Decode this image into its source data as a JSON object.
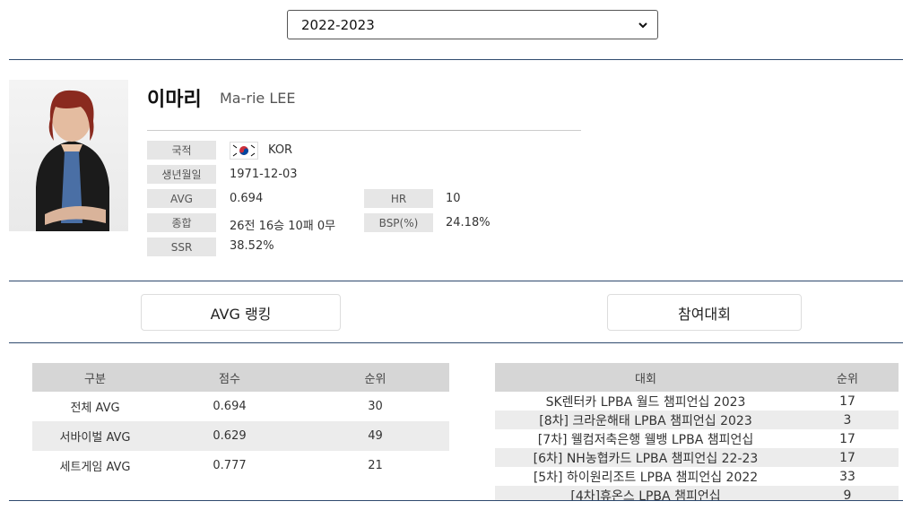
{
  "season_select": {
    "value": "2022-2023"
  },
  "player": {
    "name_ko": "이마리",
    "name_en": "Ma-rie LEE",
    "nationality_label": "국적",
    "nationality": "KOR",
    "birth_label": "생년월일",
    "birth": "1971-12-03",
    "avg_label": "AVG",
    "avg": "0.694",
    "hr_label": "HR",
    "hr": "10",
    "record_label": "종합",
    "record": "26전 16승 10패 0무",
    "bsp_label": "BSP(%)",
    "bsp": "24.18%",
    "ssr_label": "SSR",
    "ssr": "38.52%"
  },
  "tabs": {
    "avg_ranking": "AVG 랭킹",
    "tournaments": "참여대회"
  },
  "avg_table": {
    "headers": [
      "구분",
      "점수",
      "순위"
    ],
    "rows": [
      [
        "전체 AVG",
        "0.694",
        "30"
      ],
      [
        "서바이벌 AVG",
        "0.629",
        "49"
      ],
      [
        "세트게임 AVG",
        "0.777",
        "21"
      ]
    ]
  },
  "tour_table": {
    "headers": [
      "대회",
      "순위"
    ],
    "rows": [
      [
        "SK렌터카 LPBA 월드 챔피언십 2023",
        "17"
      ],
      [
        "[8차] 크라운해태 LPBA 챔피언십 2023",
        "3"
      ],
      [
        "[7차] 웰컴저축은행 웰뱅 LPBA 챔피언십",
        "17"
      ],
      [
        "[6차] NH농협카드 LPBA 챔피언십 22-23",
        "17"
      ],
      [
        "[5차] 하이원리조트 LPBA 챔피언십 2022",
        "33"
      ],
      [
        "[4차]휴온스 LPBA 챔피언십",
        "9"
      ]
    ]
  },
  "colors": {
    "divider": "#2f4a6e",
    "label_bg": "#e6e6e6",
    "header_bg": "#d6d6d6"
  }
}
